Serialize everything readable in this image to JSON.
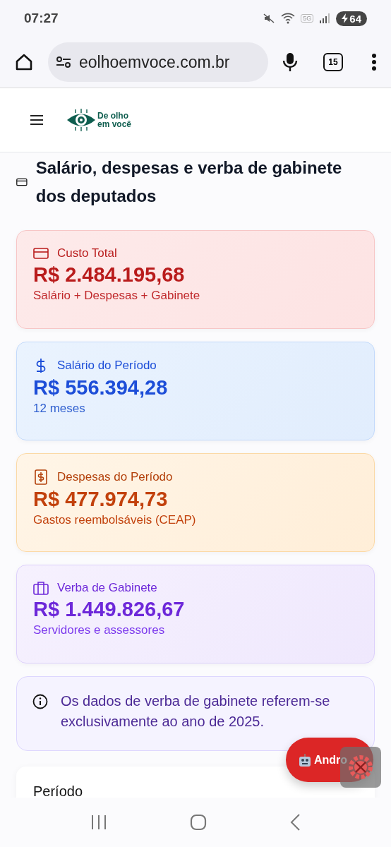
{
  "status_bar": {
    "time": "07:27",
    "network": "5G",
    "battery": "64"
  },
  "browser": {
    "url": "eolhoemvoce.com.br",
    "tab_count": "15"
  },
  "site_header": {
    "logo_text": [
      "De olho",
      "em você"
    ]
  },
  "page_title": "Salário, despesas e verba de gabinete dos deputados",
  "cards": [
    {
      "kind": "total",
      "label": "Custo Total",
      "value": "R$ 2.484.195,68",
      "note": "Salário + Despesas + Gabinete"
    },
    {
      "kind": "salary",
      "label": "Salário do Período",
      "value": "R$ 556.394,28",
      "note": "12 meses"
    },
    {
      "kind": "expenses",
      "label": "Despesas do Período",
      "value": "R$ 477.974,73",
      "note": "Gastos reembolsáveis (CEAP)"
    },
    {
      "kind": "office",
      "label": "Verba de Gabinete",
      "value": "R$ 1.449.826,67",
      "note": "Servidores e assessores"
    }
  ],
  "info_note": "Os dados de verba de gabinete referem-se exclusivamente ao ano de 2025.",
  "period_card": {
    "label": "Período"
  },
  "floating_button": {
    "label": "Andro"
  }
}
